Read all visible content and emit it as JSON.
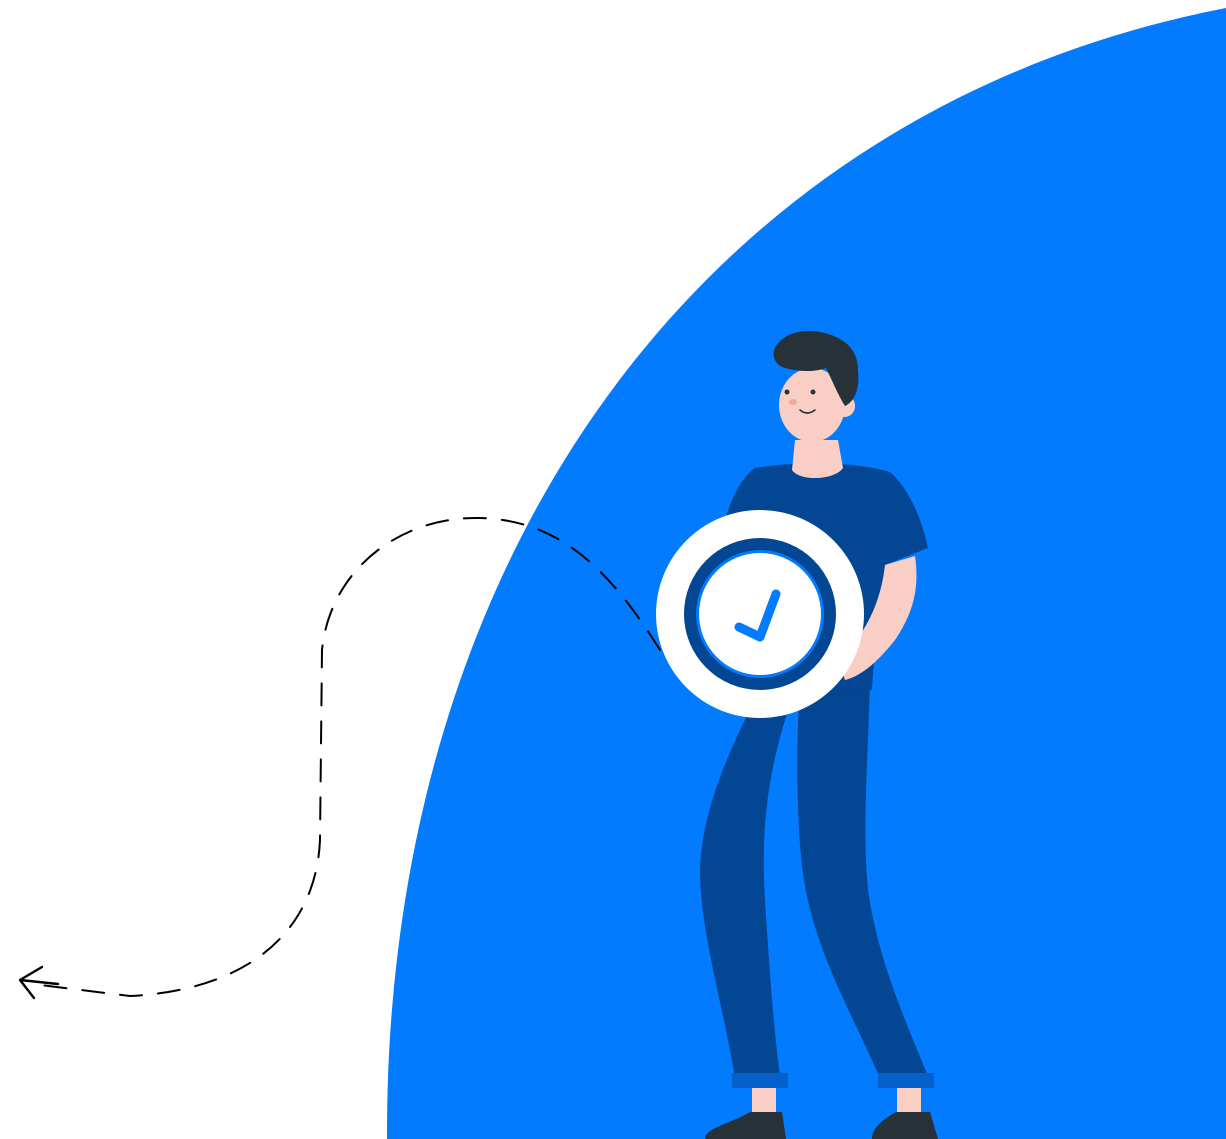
{
  "illustration": {
    "icons": {
      "arrow": "dashed-arrow-left-icon",
      "badge": "checkmark-badge-icon",
      "person": "person-figure"
    },
    "colors": {
      "background": "#ffffff",
      "accent_blue": "#037BFF",
      "navy_clothing": "#034693",
      "skin": "#F9CFC5",
      "hair": "#263238",
      "badge_white": "#ffffff",
      "arrow_stroke": "#000000"
    }
  }
}
